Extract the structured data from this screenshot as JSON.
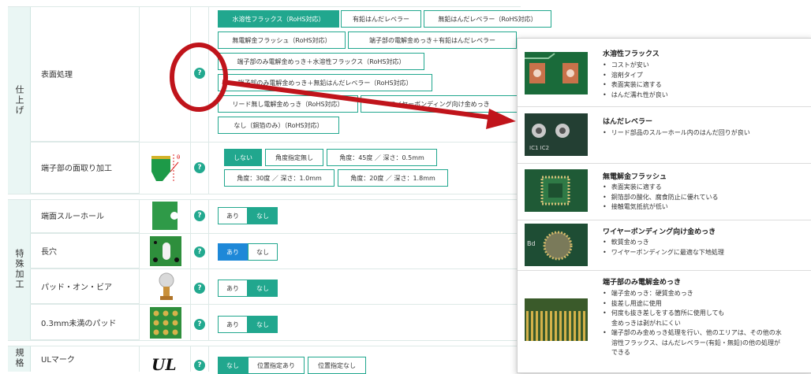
{
  "sections": {
    "finish_category": "仕上げ",
    "special_category": "特殊加工",
    "standard_category": "規格"
  },
  "rows": {
    "surface_treatment": {
      "label": "表面処理",
      "options": [
        "水溶性フラックス（RoHS対応）",
        "有鉛はんだレベラー",
        "無鉛はんだレベラー（RoHS対応）",
        "無電解金フラッシュ（RoHS対応）",
        "端子部の電解金めっき＋有鉛はんだレベラー",
        "端子部のみ電解金めっき＋水溶性フラックス（RoHS対応）",
        "端子部のみ電解金めっき＋無鉛はんだレベラー（RoHS対応）",
        "リード無し電解金めっき（RoHS対応）",
        "ワイヤーボンディング向け金めっき",
        "なし（銅箔のみ）（RoHS対応）"
      ]
    },
    "chamfer": {
      "label": "端子部の面取り加工",
      "options": [
        "しない",
        "角度指定無し",
        "角度：45度 ／ 深さ：0.5mm",
        "角度：30度 ／ 深さ：1.0mm",
        "角度：20度 ／ 深さ：1.8mm"
      ]
    },
    "edge_through_hole": {
      "label": "端面スルーホール",
      "options": [
        "あり",
        "なし"
      ]
    },
    "long_hole": {
      "label": "長穴",
      "options": [
        "あり",
        "なし"
      ]
    },
    "pad_on_via": {
      "label": "パッド・オン・ビア",
      "options": [
        "あり",
        "なし"
      ]
    },
    "small_pad": {
      "label": "0.3mm未満のパッド",
      "options": [
        "あり",
        "なし"
      ]
    },
    "ul_mark": {
      "label": "ULマーク",
      "options": [
        "なし",
        "位置指定あり",
        "位置指定なし"
      ]
    }
  },
  "help_icon": "?",
  "popup": {
    "items": [
      {
        "title": "水溶性フラックス",
        "bullets": [
          "コストが安い",
          "溶剤タイプ",
          "表面実装に適する",
          "はんだ濡れ性が良い"
        ]
      },
      {
        "title": "はんだレベラー",
        "bullets": [
          "リード部品のスルーホール内のはんだ回りが良い"
        ]
      },
      {
        "title": "無電解金フラッシュ",
        "bullets": [
          "表面実装に適する",
          "銅箔部の酸化、腐食防止に優れている",
          "接触電気抵抗が低い"
        ]
      },
      {
        "title": "ワイヤーボンディング向け金めっき",
        "bullets": [
          "軟質金めっき",
          "ワイヤーボンディングに最適な下地処理"
        ]
      },
      {
        "title": "端子部のみ電解金めっき",
        "bullets": [
          "端子金めっき：硬質金めっき",
          "抜差し用途に使用",
          "何度も抜き差しをする箇所に使用しても",
          "端子部のみ金めっき処理を行い、他のエリアは、その他の水",
          "溶性フラックス、はんだレベラー(有鉛・無鉛)の他の処理が"
        ],
        "continuations": [
          "金めっきは剥がれにくい",
          "できる"
        ]
      }
    ],
    "image_label_wire": "Bd"
  },
  "colors": {
    "accent": "#21a78e",
    "selected_blue": "#1e88d8",
    "annotation_red": "#c0141b",
    "category_bg": "#eaf6f4"
  }
}
